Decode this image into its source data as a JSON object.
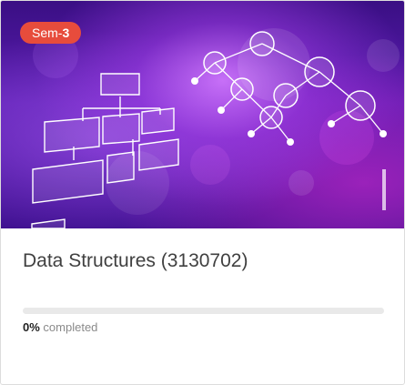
{
  "course": {
    "badge_prefix": "Sem-",
    "badge_number": "3",
    "title": "Data Structures (3130702)",
    "progress_fraction": 0,
    "progress_percent": "0%",
    "progress_suffix": "completed"
  },
  "colors": {
    "badge": "#e74c3c",
    "title_text": "#404040",
    "progress_track": "#e9e9e9",
    "muted_text": "#8a8a8a"
  }
}
